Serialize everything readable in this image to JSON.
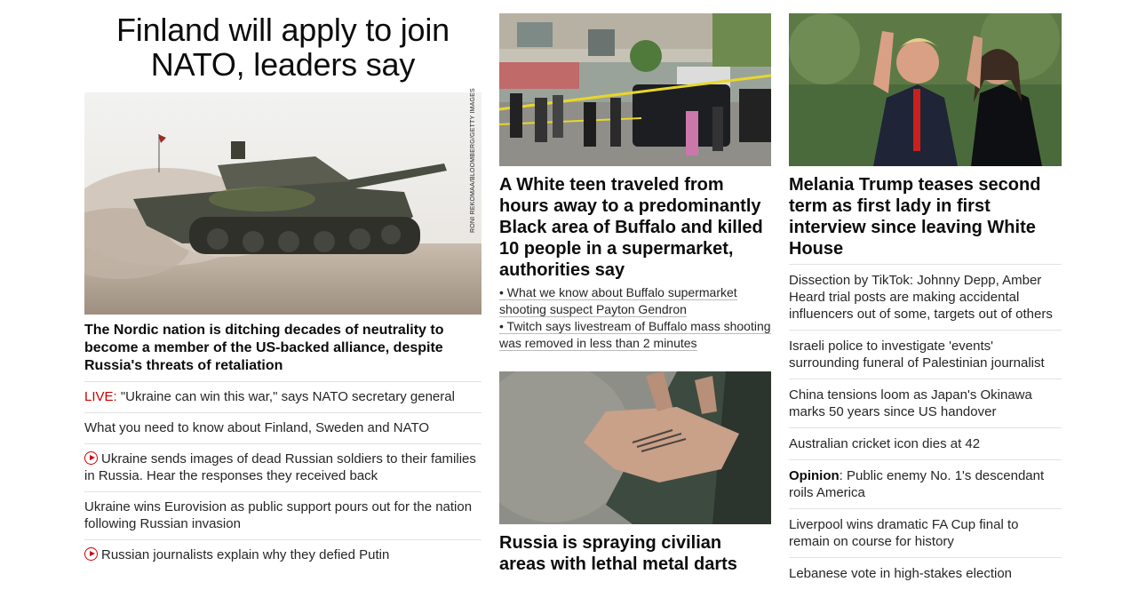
{
  "lead": {
    "headline": "Finland will apply to join NATO, leaders say",
    "image_credit": "RONI REKOMAA/BLOOMBERG/GETTY IMAGES",
    "summary": "The Nordic nation is ditching decades of neutrality to become a member of the US-backed alliance, despite Russia's threats of retaliation",
    "related": [
      {
        "prefix": "LIVE:",
        "text": " \"Ukraine can win this war,\" says NATO secretary general"
      },
      {
        "text": "What you need to know about Finland, Sweden and NATO"
      },
      {
        "video": true,
        "text": "Ukraine sends images of dead Russian soldiers to their families in Russia. Hear the responses they received back"
      },
      {
        "text": "Ukraine wins Eurovision as public support pours out for the nation following Russian invasion"
      },
      {
        "video": true,
        "text": "Russian journalists explain why they defied Putin"
      }
    ]
  },
  "buffalo": {
    "headline": "A White teen traveled from hours away to a predominantly Black area of Buffalo and killed 10 people in a supermarket, authorities say",
    "bullets": [
      "• What we know about Buffalo supermarket shooting suspect Payton Gendron",
      "• Twitch says livestream of Buffalo mass shooting was removed in less than 2 minutes"
    ]
  },
  "darts": {
    "headline": "Russia is spraying civilian areas with lethal metal darts"
  },
  "melania": {
    "headline": "Melania Trump teases second term as first lady in first interview since leaving White House",
    "stories": [
      {
        "text": "Dissection by TikTok: Johnny Depp, Amber Heard trial posts are making accidental influencers out of some, targets out of others"
      },
      {
        "text": "Israeli police to investigate 'events' surrounding funeral of Palestinian journalist"
      },
      {
        "text": "China tensions loom as Japan's Okinawa marks 50 years since US handover"
      },
      {
        "text": "Australian cricket icon dies at 42"
      },
      {
        "prefix": "Opinion",
        "text": ": Public enemy No. 1's descendant roils America"
      },
      {
        "text": "Liverpool wins dramatic FA Cup final to remain on course for history"
      },
      {
        "text": "Lebanese vote in high-stakes election"
      }
    ]
  },
  "colors": {
    "live_red": "#cc0000",
    "divider": "#e2e2e2",
    "text": "#262626"
  }
}
